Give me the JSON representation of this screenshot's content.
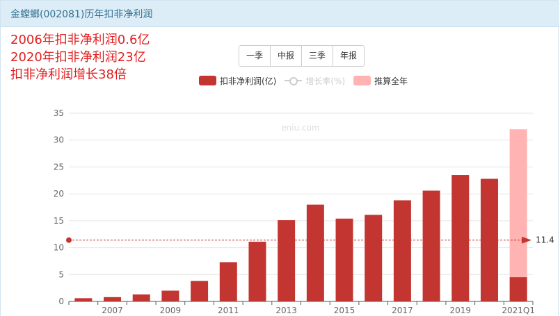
{
  "header": {
    "title": "金螳螂(002081)历年扣非净利润"
  },
  "notes": [
    "2006年扣非净利润0.6亿",
    "2020年扣非净利润23亿",
    "扣非净利润增长38倍"
  ],
  "period_buttons": [
    "一季",
    "中报",
    "三季",
    "年报"
  ],
  "legend": {
    "items": [
      {
        "label": "扣非净利润(亿)",
        "color": "#c23531"
      },
      {
        "label": "增长率(%)",
        "color": "#cccccc"
      },
      {
        "label": "推算全年",
        "color": "#ffb3b3"
      }
    ]
  },
  "watermark": "eniu.com",
  "chart_data": {
    "type": "bar",
    "categories": [
      "2006",
      "2007",
      "2008",
      "2009",
      "2010",
      "2011",
      "2012",
      "2013",
      "2014",
      "2015",
      "2016",
      "2017",
      "2018",
      "2019",
      "2020",
      "2021Q1"
    ],
    "x_tick_labels": [
      "2007",
      "2009",
      "2011",
      "2013",
      "2015",
      "2017",
      "2019",
      "2021Q1"
    ],
    "series": [
      {
        "name": "扣非净利润(亿)",
        "color": "#c23531",
        "values": [
          0.6,
          0.8,
          1.3,
          2.0,
          3.8,
          7.3,
          11.1,
          15.1,
          18.0,
          15.4,
          16.1,
          18.8,
          20.6,
          23.5,
          22.8,
          4.5
        ]
      },
      {
        "name": "推算全年",
        "color": "#ffb3b3",
        "values": [
          null,
          null,
          null,
          null,
          null,
          null,
          null,
          null,
          null,
          null,
          null,
          null,
          null,
          null,
          null,
          32.0
        ]
      }
    ],
    "ylim": [
      0,
      35
    ],
    "yticks": [
      0,
      5,
      10,
      15,
      20,
      25,
      30,
      35
    ],
    "average_line": {
      "value": 11.4,
      "label": "11.4",
      "color": "#c23531"
    },
    "grid": true,
    "legend_position": "top"
  }
}
